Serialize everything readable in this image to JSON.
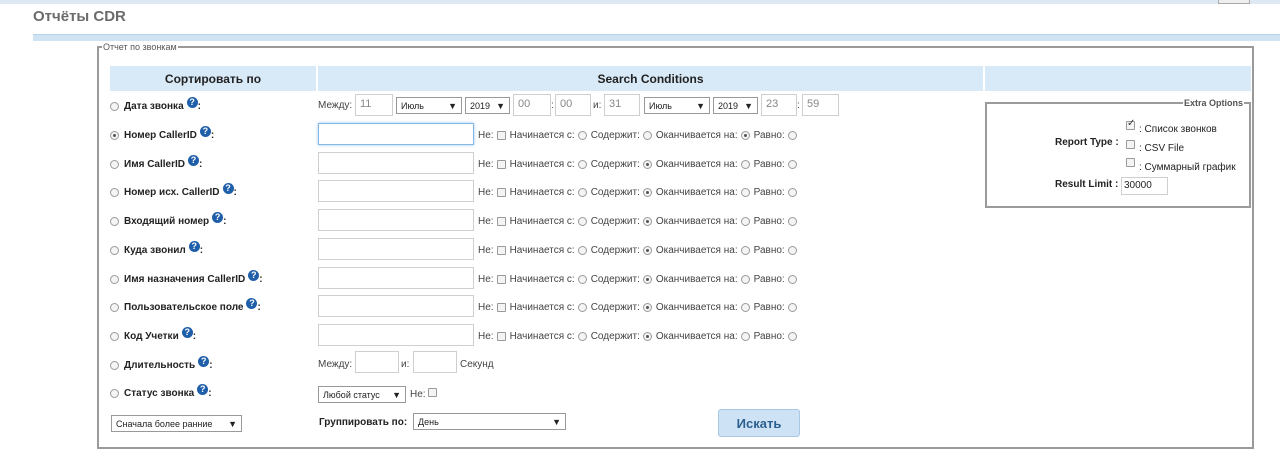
{
  "page": {
    "title": "Отчёты CDR"
  },
  "report": {
    "legend": "Отчет по звонкам",
    "headers": {
      "sort": "Сортировать по",
      "conditions": "Search Conditions"
    },
    "rows": [
      {
        "label": "Дата звонка",
        "selected": false
      },
      {
        "label": "Номер CallerID",
        "selected": true
      },
      {
        "label": "Имя CallerID",
        "selected": false
      },
      {
        "label": "Номер исх. CallerID",
        "selected": false
      },
      {
        "label": "Входящий номер",
        "selected": false
      },
      {
        "label": "Куда звонил",
        "selected": false
      },
      {
        "label": "Имя назначения CallerID",
        "selected": false
      },
      {
        "label": "Пользовательское поле",
        "selected": false
      },
      {
        "label": "Код Учетки",
        "selected": false
      },
      {
        "label": "Длительность",
        "selected": false
      },
      {
        "label": "Статус звонка",
        "selected": false
      }
    ],
    "help_glyph": "?",
    "colon": ":",
    "date_range": {
      "between_label": "Между:",
      "and_label": "и:",
      "from": {
        "day": "11",
        "month": "Июль",
        "year": "2019",
        "hour": "00",
        "minute": "00"
      },
      "to": {
        "day": "31",
        "month": "Июль",
        "year": "2019",
        "hour": "23",
        "minute": "59"
      }
    },
    "match_options": {
      "not_label": "Не:",
      "begins_label": "Начинается с:",
      "contains_label": "Содержит:",
      "ends_label": "Оканчивается на:",
      "equals_label": "Равно:"
    },
    "duration": {
      "between_label": "Между:",
      "and_label": "и:",
      "unit_label": "Секунд"
    },
    "status": {
      "selected": "Любой статус",
      "not_label": "Не:"
    },
    "order": {
      "selected": "Сначала более ранние"
    },
    "group_by": {
      "label": "Группировать по:",
      "selected": "День"
    },
    "search_button": "Искать",
    "extra_options": {
      "legend": "Extra Options",
      "report_type_label": "Report Type :",
      "types": [
        {
          "label": ": Список звонков",
          "checked": true
        },
        {
          "label": ": CSV File",
          "checked": false
        },
        {
          "label": ": Суммарный график",
          "checked": false
        }
      ],
      "result_limit_label": "Result Limit :",
      "result_limit_value": "30000"
    }
  }
}
